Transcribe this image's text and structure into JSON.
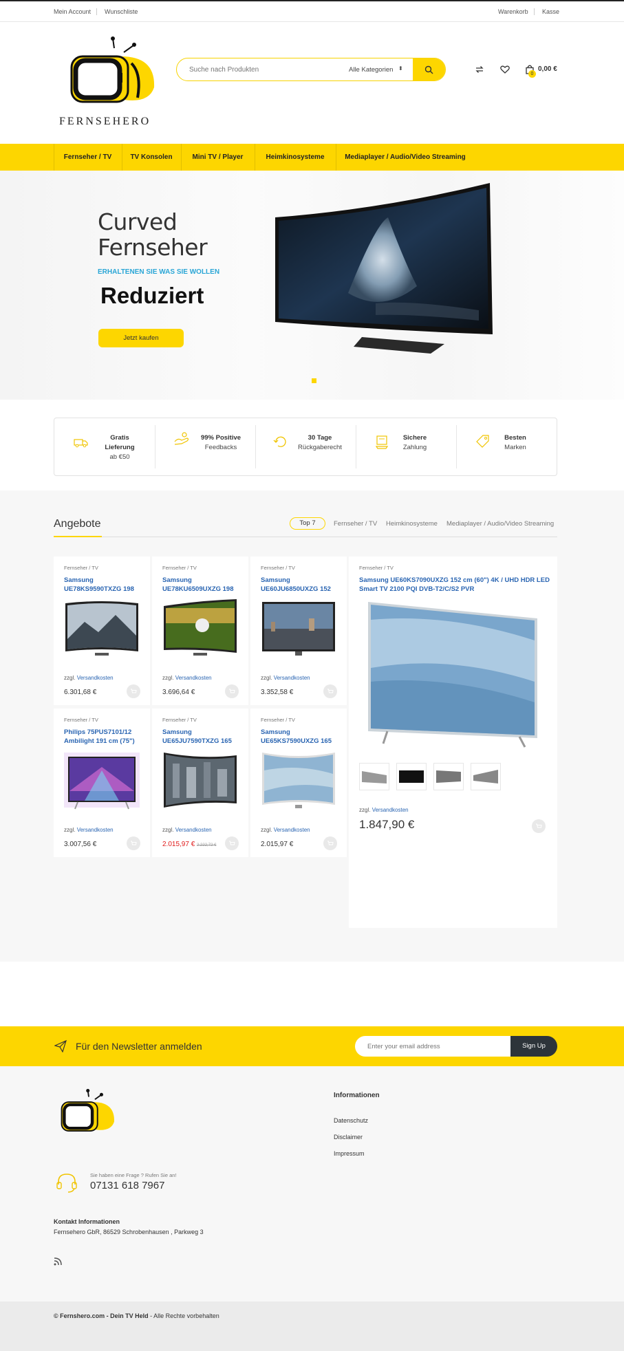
{
  "topbar": {
    "my_account": "Mein Account",
    "wishlist": "Wunschliste",
    "cart": "Warenkorb",
    "checkout": "Kasse"
  },
  "header": {
    "logo_text": "FERNSEHERO",
    "search_placeholder": "Suche nach Produkten",
    "category_select": "Alle Kategorien",
    "cart_count": "0",
    "cart_total": "0,00 €",
    "icons": [
      "compare-icon",
      "heart-icon",
      "shopping-bag-icon",
      "search-icon"
    ],
    "accent_color": "#fdd600"
  },
  "nav": {
    "items": [
      {
        "label": "Fernseher / TV"
      },
      {
        "label": "TV Konsolen"
      },
      {
        "label": "Mini TV / Player"
      },
      {
        "label": "Heimkinosysteme"
      },
      {
        "label": "Mediaplayer / Audio/Video Streaming"
      }
    ]
  },
  "hero": {
    "title_line1": "Curved",
    "title_line2": "Fernseher",
    "subtitle": "ERHALTENEN SIE WAS SIE WOLLEN",
    "headline": "Reduziert",
    "button": "Jetzt kaufen"
  },
  "features": [
    {
      "title": "Gratis",
      "title2": "Lieferung",
      "sub": "ab €50",
      "icon": "truck-icon"
    },
    {
      "title": "99% Positive",
      "sub": "Feedbacks",
      "icon": "feedback-icon"
    },
    {
      "title": "30 Tage",
      "sub": "Rückgaberecht",
      "icon": "return-icon"
    },
    {
      "title": "Sichere",
      "sub": "Zahlung",
      "icon": "payment-icon"
    },
    {
      "title": "Besten",
      "sub": "Marken",
      "icon": "tag-icon"
    }
  ],
  "offers": {
    "title": "Angebote",
    "tabs": [
      "Top 7",
      "Fernseher / TV",
      "Heimkinosysteme",
      "Mediaplayer / Audio/Video Streaming"
    ],
    "ship_prefix": "zzgl.",
    "ship_link": "Versandkosten",
    "products": [
      {
        "cat": "Fernseher / TV",
        "name": "Samsung UE78KS9590TXZG 198",
        "price": "6.301,68 €"
      },
      {
        "cat": "Fernseher / TV",
        "name": "Samsung UE78KU6509UXZG 198",
        "price": "3.696,64 €"
      },
      {
        "cat": "Fernseher / TV",
        "name": "Samsung UE60JU6850UXZG 152",
        "price": "3.352,58 €"
      },
      {
        "cat": "Fernseher / TV",
        "name": "Philips 75PUS7101/12 Ambilight 191 cm (75\")",
        "price": "3.007,56 €"
      },
      {
        "cat": "Fernseher / TV",
        "name": "Samsung UE65JU7590TXZG 165",
        "price": "2.015,97 €",
        "old_price": "2.222,72 €"
      },
      {
        "cat": "Fernseher / TV",
        "name": "Samsung UE65KS7590UXZG 165",
        "price": "2.015,97 €"
      }
    ],
    "featured": {
      "cat": "Fernseher / TV",
      "name": "Samsung UE60KS7090UXZG 152 cm (60\") 4K / UHD HDR LED Smart TV 2100 PQI DVB-T2/C/S2 PVR",
      "price": "1.847,90 €"
    }
  },
  "newsletter": {
    "title": "Für den Newsletter anmelden",
    "placeholder": "Enter your email address",
    "button": "Sign Up"
  },
  "footer": {
    "info_heading": "Informationen",
    "links": [
      "Datenschutz",
      "Disclaimer",
      "Impressum"
    ],
    "ask": "Sie haben eine Frage ? Rufen Sie an!",
    "phone": "07131 618 7967",
    "contact_title": "Kontakt Informationen",
    "address": "Fernsehero GbR, 86529 Schrobenhausen , Parkweg 3",
    "copyright_bold": "© Fernshero.com - Dein TV Held",
    "copyright_rest": " - Alle Rechte vorbehalten"
  }
}
